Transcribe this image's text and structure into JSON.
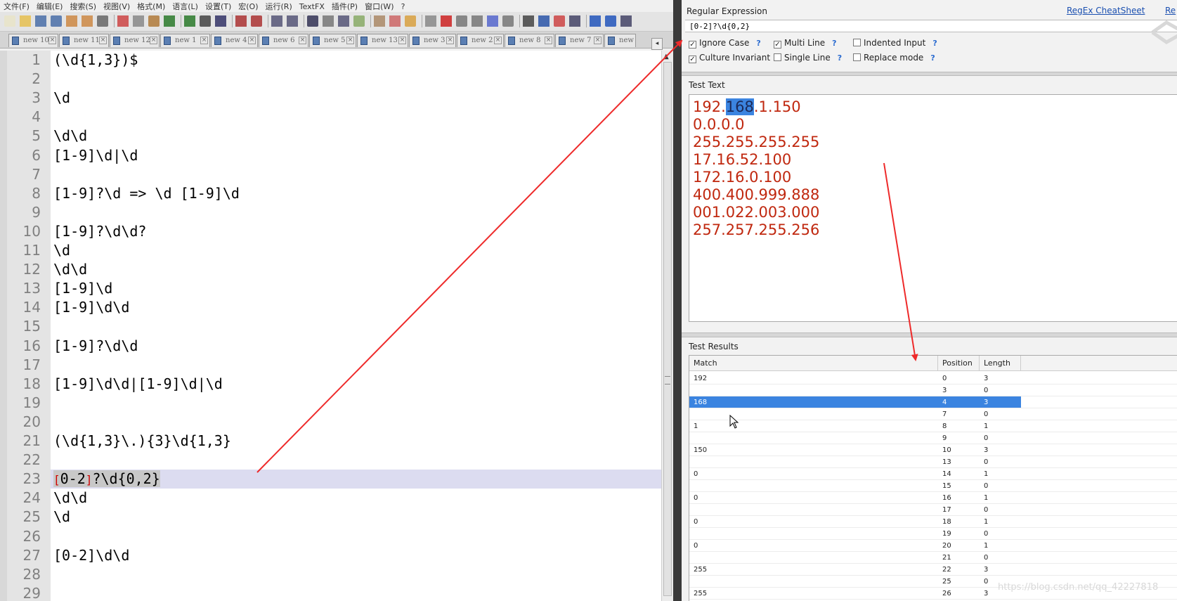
{
  "menu": [
    "文件(F)",
    "编辑(E)",
    "搜索(S)",
    "视图(V)",
    "格式(M)",
    "语言(L)",
    "设置(T)",
    "宏(O)",
    "运行(R)",
    "TextFX",
    "插件(P)",
    "窗口(W)",
    "?"
  ],
  "tabs": [
    "new 10",
    "new 11",
    "new 12",
    "new 1",
    "new 4",
    "new 6",
    "new 5",
    "new 13",
    "new 3",
    "new 2",
    "new 8",
    "new 7",
    "new"
  ],
  "editor": {
    "lines": [
      {
        "n": "1",
        "text": "(\\d{1,3})$"
      },
      {
        "n": "2",
        "text": ""
      },
      {
        "n": "3",
        "text": "\\d"
      },
      {
        "n": "4",
        "text": ""
      },
      {
        "n": "5",
        "text": "\\d\\d"
      },
      {
        "n": "6",
        "text": "[1-9]\\d|\\d"
      },
      {
        "n": "7",
        "text": ""
      },
      {
        "n": "8",
        "text": "[1-9]?\\d => \\d [1-9]\\d"
      },
      {
        "n": "9",
        "text": ""
      },
      {
        "n": "10",
        "text": "[1-9]?\\d\\d?"
      },
      {
        "n": "11",
        "text": "\\d"
      },
      {
        "n": "12",
        "text": "\\d\\d"
      },
      {
        "n": "13",
        "text": "[1-9]\\d"
      },
      {
        "n": "14",
        "text": "[1-9]\\d\\d"
      },
      {
        "n": "15",
        "text": ""
      },
      {
        "n": "16",
        "text": "[1-9]?\\d\\d"
      },
      {
        "n": "17",
        "text": ""
      },
      {
        "n": "18",
        "text": "[1-9]\\d\\d|[1-9]\\d|\\d"
      },
      {
        "n": "19",
        "text": ""
      },
      {
        "n": "20",
        "text": ""
      },
      {
        "n": "21",
        "text": "(\\d{1,3}\\.){3}\\d{1,3}"
      },
      {
        "n": "22",
        "text": ""
      },
      {
        "n": "23",
        "text": "[0-2]?\\d{0,2}",
        "bracket_open": "[",
        "bracket_inner": "0-2",
        "bracket_close": "]",
        "rest": "?\\d{0,2}"
      },
      {
        "n": "24",
        "text": "\\d\\d"
      },
      {
        "n": "25",
        "text": "\\d"
      },
      {
        "n": "26",
        "text": ""
      },
      {
        "n": "27",
        "text": "[0-2]\\d\\d"
      },
      {
        "n": "28",
        "text": ""
      },
      {
        "n": "29",
        "text": ""
      }
    ],
    "current_line": "23"
  },
  "regex_panel": {
    "section_title": "Regular Expression",
    "cheatsheet_link": "RegEx CheatSheet",
    "cut_link": "Re",
    "expression": "[0-2]?\\d{0,2}",
    "options": [
      {
        "label": "Ignore Case",
        "checked": true
      },
      {
        "label": "Multi Line",
        "checked": true
      },
      {
        "label": "Indented Input",
        "checked": false
      },
      {
        "label": "Culture Invariant",
        "checked": true
      },
      {
        "label": "Single Line",
        "checked": false
      },
      {
        "label": "Replace mode",
        "checked": false
      }
    ],
    "help_mark": "?",
    "check_mark": "✓"
  },
  "test_text": {
    "section_title": "Test Text",
    "lines": [
      "192.168.1.150",
      "0.0.0.0",
      "255.255.255.255",
      "17.16.52.100",
      "172.16.0.100",
      "400.400.999.888",
      "001.022.003.000",
      "257.257.255.256"
    ],
    "first_line_parts": [
      "192.",
      "168",
      ".1.150"
    ]
  },
  "test_results": {
    "section_title": "Test Results",
    "columns": [
      "Match",
      "Position",
      "Length"
    ],
    "rows": [
      {
        "match": "192",
        "position": "0",
        "length": "3"
      },
      {
        "match": "",
        "position": "3",
        "length": "0"
      },
      {
        "match": "168",
        "position": "4",
        "length": "3",
        "selected": true
      },
      {
        "match": "",
        "position": "7",
        "length": "0"
      },
      {
        "match": "1",
        "position": "8",
        "length": "1"
      },
      {
        "match": "",
        "position": "9",
        "length": "0"
      },
      {
        "match": "150",
        "position": "10",
        "length": "3"
      },
      {
        "match": "",
        "position": "13",
        "length": "0"
      },
      {
        "match": "0",
        "position": "14",
        "length": "1"
      },
      {
        "match": "",
        "position": "15",
        "length": "0"
      },
      {
        "match": "0",
        "position": "16",
        "length": "1"
      },
      {
        "match": "",
        "position": "17",
        "length": "0"
      },
      {
        "match": "0",
        "position": "18",
        "length": "1"
      },
      {
        "match": "",
        "position": "19",
        "length": "0"
      },
      {
        "match": "0",
        "position": "20",
        "length": "1"
      },
      {
        "match": "",
        "position": "21",
        "length": "0"
      },
      {
        "match": "255",
        "position": "22",
        "length": "3"
      },
      {
        "match": "",
        "position": "25",
        "length": "0"
      },
      {
        "match": "255",
        "position": "26",
        "length": "3"
      }
    ]
  },
  "watermark": "https://blog.csdn.net/qq_42227818",
  "colors": {
    "annotation_arrow": "#ee2a2a",
    "test_text": "#c0280f",
    "selection": "#3b84e0",
    "link": "#1a4fb0"
  }
}
